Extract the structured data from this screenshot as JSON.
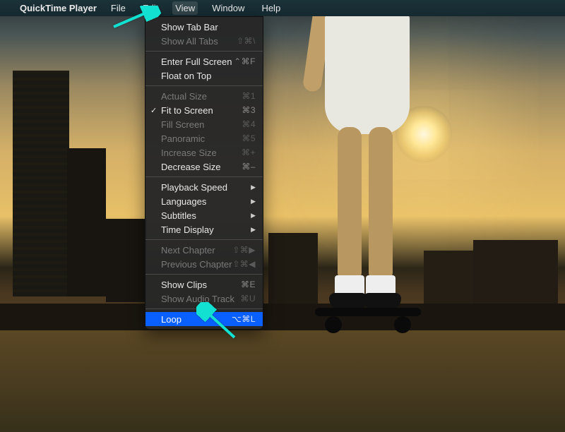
{
  "menubar": {
    "app_name": "QuickTime Player",
    "items": [
      "File",
      "Edit",
      "View",
      "Window",
      "Help"
    ],
    "active_index": 2
  },
  "view_menu": {
    "groups": [
      [
        {
          "label": "Show Tab Bar",
          "shortcut": "",
          "enabled": true
        },
        {
          "label": "Show All Tabs",
          "shortcut": "⇧⌘\\",
          "enabled": false
        }
      ],
      [
        {
          "label": "Enter Full Screen",
          "shortcut": "⌃⌘F",
          "enabled": true
        },
        {
          "label": "Float on Top",
          "shortcut": "",
          "enabled": true
        }
      ],
      [
        {
          "label": "Actual Size",
          "shortcut": "⌘1",
          "enabled": false
        },
        {
          "label": "Fit to Screen",
          "shortcut": "⌘3",
          "enabled": true,
          "checked": true
        },
        {
          "label": "Fill Screen",
          "shortcut": "⌘4",
          "enabled": false
        },
        {
          "label": "Panoramic",
          "shortcut": "⌘5",
          "enabled": false
        },
        {
          "label": "Increase Size",
          "shortcut": "⌘+",
          "enabled": false
        },
        {
          "label": "Decrease Size",
          "shortcut": "⌘–",
          "enabled": true
        }
      ],
      [
        {
          "label": "Playback Speed",
          "submenu": true,
          "enabled": true
        },
        {
          "label": "Languages",
          "submenu": true,
          "enabled": true
        },
        {
          "label": "Subtitles",
          "submenu": true,
          "enabled": true
        },
        {
          "label": "Time Display",
          "submenu": true,
          "enabled": true
        }
      ],
      [
        {
          "label": "Next Chapter",
          "shortcut": "⇧⌘▶",
          "enabled": false
        },
        {
          "label": "Previous Chapter",
          "shortcut": "⇧⌘◀",
          "enabled": false
        }
      ],
      [
        {
          "label": "Show Clips",
          "shortcut": "⌘E",
          "enabled": true
        },
        {
          "label": "Show Audio Track",
          "shortcut": "⌘U",
          "enabled": false
        }
      ],
      [
        {
          "label": "Loop",
          "shortcut": "⌥⌘L",
          "enabled": true,
          "highlighted": true
        }
      ]
    ]
  },
  "annotations": {
    "arrow_color": "#12e0d0"
  }
}
